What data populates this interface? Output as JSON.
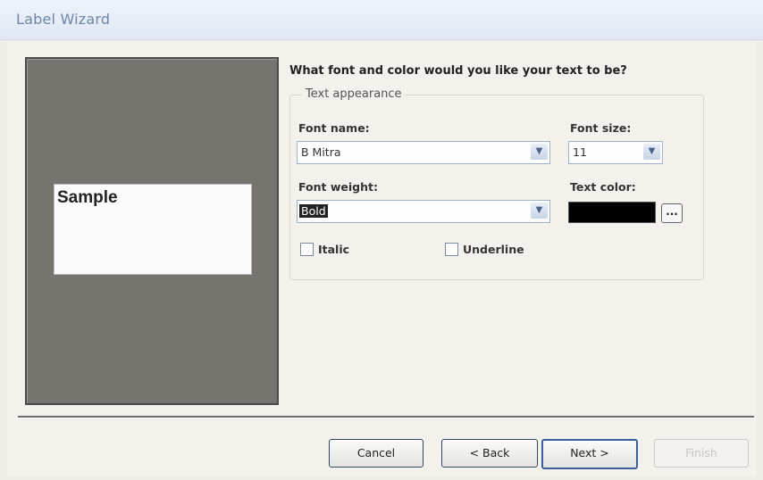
{
  "window": {
    "title": "Label Wizard"
  },
  "preview": {
    "sample_text": "Sample"
  },
  "prompt": {
    "question": "What font and color would you like your text to be?"
  },
  "appearance": {
    "group_title": "Text appearance",
    "font_name": {
      "label": "Font name:",
      "value": "B Mitra"
    },
    "font_size": {
      "label": "Font size:",
      "value": "11"
    },
    "font_weight": {
      "label": "Font weight:",
      "value": "Bold"
    },
    "text_color": {
      "label": "Text color:",
      "value": "#000000",
      "button_label": "..."
    },
    "italic": {
      "label": "Italic",
      "checked": false
    },
    "underline": {
      "label": "Underline",
      "checked": false
    }
  },
  "buttons": {
    "cancel": "Cancel",
    "back": "< Back",
    "next": "Next >",
    "finish": "Finish"
  }
}
